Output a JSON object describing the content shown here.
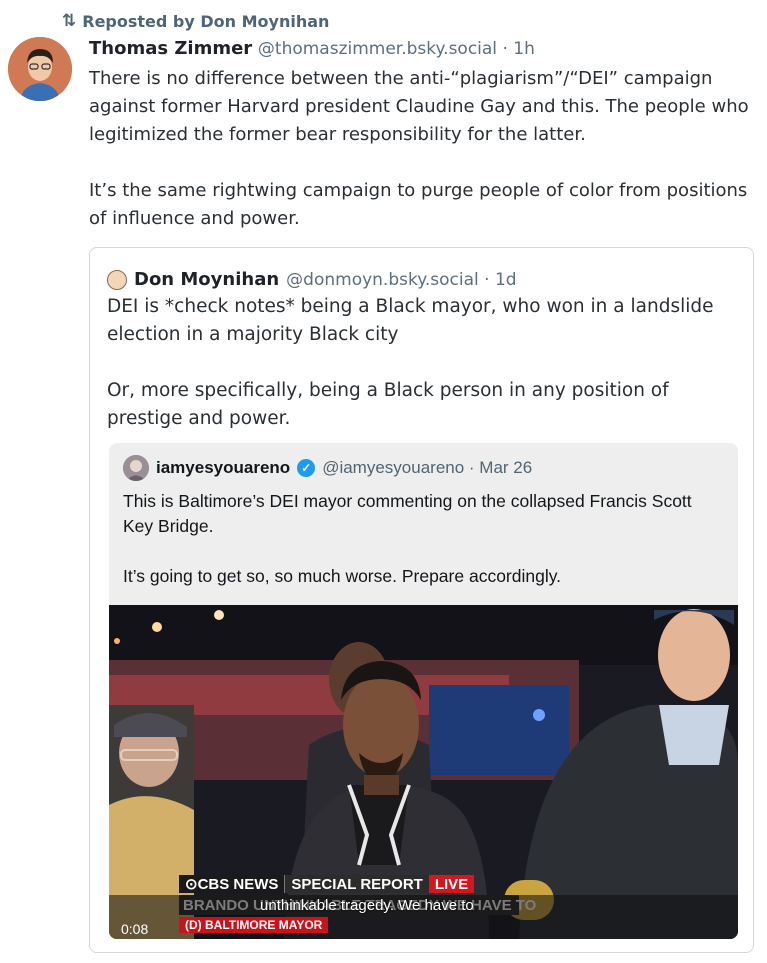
{
  "repost": {
    "icon": "repost-icon",
    "label": "Reposted by Don Moynihan"
  },
  "post": {
    "author": "Thomas Zimmer",
    "handle": "@thomaszimmer.bsky.social · 1h",
    "paragraphs": [
      "There is no difference between the anti-“plagiarism”/“DEI” campaign against former Harvard president Claudine Gay and this. The people who legitimized the former bear responsibility for the latter.",
      "It’s the same rightwing campaign to purge people of color from positions of influence and power."
    ]
  },
  "quote": {
    "author": "Don Moynihan",
    "handle": "@donmoyn.bsky.social · 1d",
    "paragraphs": [
      "DEI is *check notes* being a Black mayor, who won in a landslide election in a majority Black city",
      "Or, more specifically, being a Black person in any position of prestige and power."
    ]
  },
  "tweet": {
    "author": "iamyesyouareno",
    "handle": "@iamyesyouareno · Mar 26",
    "paragraphs": [
      "This is Baltimore’s DEI mayor commenting on the collapsed Francis Scott Key Bridge.",
      "It’s going to get so, so much worse. Prepare accordingly."
    ]
  },
  "video": {
    "network": "⊙CBS NEWS",
    "program": "SPECIAL REPORT",
    "live": "LIVE",
    "caption_ghost": "BRANDO   UNTHINKABLE TRAGEDY   WE HAVE TO",
    "caption": "unthinkable tragedy. We have to",
    "name_tag": "(D) BALTIMORE MAYOR",
    "timestamp": "0:08"
  },
  "colors": {
    "handle": "#5c6f80",
    "verified": "#1d9bf0",
    "live": "#d3171f"
  }
}
